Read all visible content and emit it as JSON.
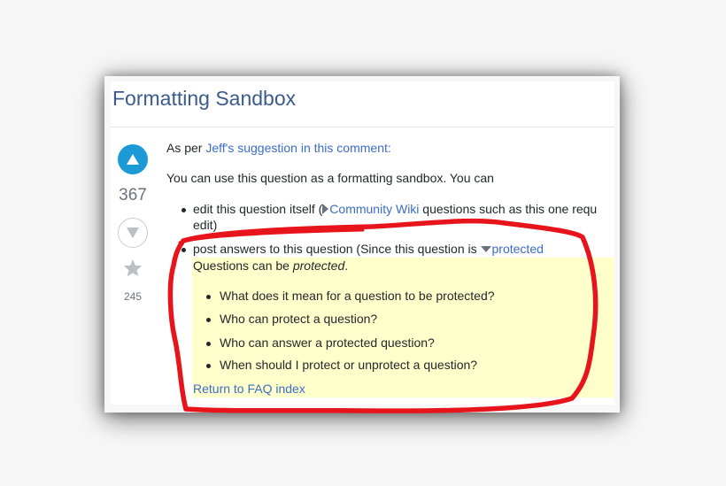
{
  "question": {
    "title": "Formatting Sandbox"
  },
  "votes": {
    "score": "367",
    "favorite_count": "245",
    "upvote_icon": "arrow-up-icon",
    "downvote_icon": "arrow-down-icon",
    "favorite_icon": "star-icon"
  },
  "body": {
    "intro_prefix": "As per ",
    "intro_link": "Jeff's suggestion in this comment:",
    "paragraph": "You can use this question as a formatting sandbox. You can",
    "bullet1": {
      "prefix": "edit this question itself (",
      "link": "Community Wiki",
      "suffix": " questions such as this one requ",
      "continuation": "edit)"
    },
    "bullet2": {
      "prefix": "post answers to this question (Since this question is ",
      "link": "protected"
    }
  },
  "protected_popup": {
    "intro_text": "Questions can be ",
    "intro_emphasis": "protected",
    "intro_end": ".",
    "faq_items": [
      "What does it mean for a question to be protected?",
      "Who can protect a question?",
      "Who can answer a protected question?",
      "When should I protect or unprotect a question?"
    ],
    "return_link": "Return to FAQ index"
  },
  "colors": {
    "title": "#3a5b8c",
    "link": "#3b6cc6",
    "upvote_active": "#1c9ad6",
    "popup_background": "#ffffcc",
    "annotation": "#e8141b"
  }
}
